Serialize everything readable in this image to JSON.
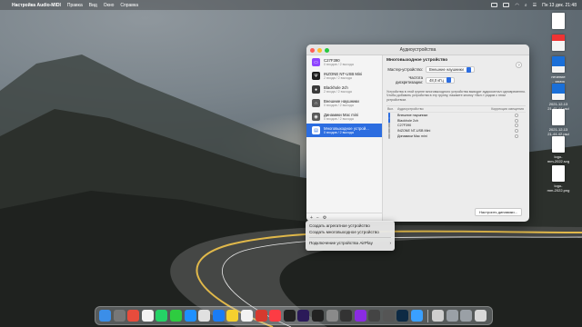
{
  "menubar": {
    "apple_glyph": "",
    "app": "Настройка Audio-MIDI",
    "items": [
      "Правка",
      "Вид",
      "Окно",
      "Справка"
    ],
    "clock": "Пн 13 дек. 21:48"
  },
  "desktop_files": [
    {
      "label": "",
      "kind": "doc"
    },
    {
      "label": "",
      "kind": "red"
    },
    {
      "label": "печение\n.. замок",
      "kind": "blue"
    },
    {
      "label": "2021-12-13\n21-45-44.psd",
      "kind": "blue"
    },
    {
      "label": "2021-12-13\n21-44-42.psd",
      "kind": "doc"
    },
    {
      "label": "logo-\nmm-2022.svg",
      "kind": "doc"
    },
    {
      "label": "logo-\nmm-2022.png",
      "kind": "doc"
    }
  ],
  "window": {
    "title": "Аудиоустройства",
    "devices": [
      {
        "name": "C27F390",
        "sub": "0 входов / 2 выхода",
        "color": "#8e44ff",
        "icon": "display-icon"
      },
      {
        "name": "INZONE NT-USB Mini",
        "sub": "2 входа / 2 выхода",
        "color": "#1c1c1c",
        "icon": "usb-icon"
      },
      {
        "name": "Blackhole 2ch",
        "sub": "2 входа / 2 выхода",
        "color": "#3a3a3a",
        "icon": "blackhole-icon"
      },
      {
        "name": "Внешние наушники",
        "sub": "0 входов / 2 выхода",
        "color": "#5a5a5a",
        "icon": "headphones-icon"
      },
      {
        "name": "Динамики Mac mini",
        "sub": "0 входов / 2 выхода",
        "color": "#5a5a5a",
        "icon": "speaker-icon"
      },
      {
        "name": "Многовыходное устрой...",
        "sub": "0 входов / 2 выхода",
        "color": "#ffffff",
        "icon": "multi-output-icon",
        "selected": true
      }
    ],
    "footer": {
      "add": "+",
      "remove": "−",
      "gear": "⚙"
    },
    "panel": {
      "title": "Многовыходное устройство",
      "master_label": "Мастер-устройство:",
      "master_value": "Внешние наушники",
      "rate_label": "Частота дискретизации:",
      "rate_value": "48,0 кГц",
      "description": "Устройства в этой группе многовыходного устройства выводят аудиосигнал одновременно. Чтобы добавить устройства в эту группу, нажмите кнопку «Вкл.» рядом с этим устройством.",
      "col_use": "Вкл.",
      "col_device": "Аудиоустройство",
      "col_drift": "Коррекция смещения",
      "rows": [
        {
          "name": "Внешние наушники",
          "on": true
        },
        {
          "name": "Blackhole 2ch",
          "on": true
        },
        {
          "name": "C27F390",
          "on": false
        },
        {
          "name": "INZONE NT-USB Mini",
          "on": false
        },
        {
          "name": "Динамики Mac mini",
          "on": false
        }
      ],
      "configure_button": "Настроить динамики..."
    }
  },
  "context_menu": {
    "items": [
      "Создать агрегатное устройство",
      "Создать многовыходное устройство"
    ],
    "airplay": "Подключение устройства AirPlay"
  },
  "dock": [
    {
      "name": "finder-icon",
      "color": "#3b8ee8"
    },
    {
      "name": "launchpad-icon",
      "color": "#777"
    },
    {
      "name": "stickies-icon",
      "color": "#e74c3c"
    },
    {
      "name": "calendar-icon",
      "color": "#f2f2f2"
    },
    {
      "name": "whatsapp-icon",
      "color": "#25d366"
    },
    {
      "name": "messages-icon",
      "color": "#2ecc40"
    },
    {
      "name": "safari-icon",
      "color": "#1e90ff"
    },
    {
      "name": "chrome-icon",
      "color": "#e0e0e0"
    },
    {
      "name": "appstore-icon",
      "color": "#1a7cf5"
    },
    {
      "name": "notes-icon",
      "color": "#f5d02e"
    },
    {
      "name": "photos-icon",
      "color": "#f2f2f2"
    },
    {
      "name": "adobe-icon",
      "color": "#d63a2e"
    },
    {
      "name": "music-icon",
      "color": "#fc3c44"
    },
    {
      "name": "finalcut-icon",
      "color": "#222"
    },
    {
      "name": "premiere-icon",
      "color": "#2b1a59"
    },
    {
      "name": "terminal-icon",
      "color": "#222"
    },
    {
      "name": "settings-icon",
      "color": "#8a8a8a"
    },
    {
      "name": "screen-icon",
      "color": "#333"
    },
    {
      "name": "podcast-icon",
      "color": "#8a2be2"
    },
    {
      "name": "audiomidi-icon",
      "color": "#444"
    },
    {
      "name": "keyboard-icon",
      "color": "#555"
    },
    {
      "name": "photoshop-icon",
      "color": "#0d2a44"
    },
    {
      "name": "browser-icon",
      "color": "#3aa0ff"
    },
    {
      "name": "preview-icon",
      "color": "#cfcfcf"
    },
    {
      "name": "window-icon",
      "color": "#9aa0a6"
    },
    {
      "name": "window2-icon",
      "color": "#9aa0a6"
    },
    {
      "name": "trash-icon",
      "color": "#d8d8d8"
    }
  ]
}
